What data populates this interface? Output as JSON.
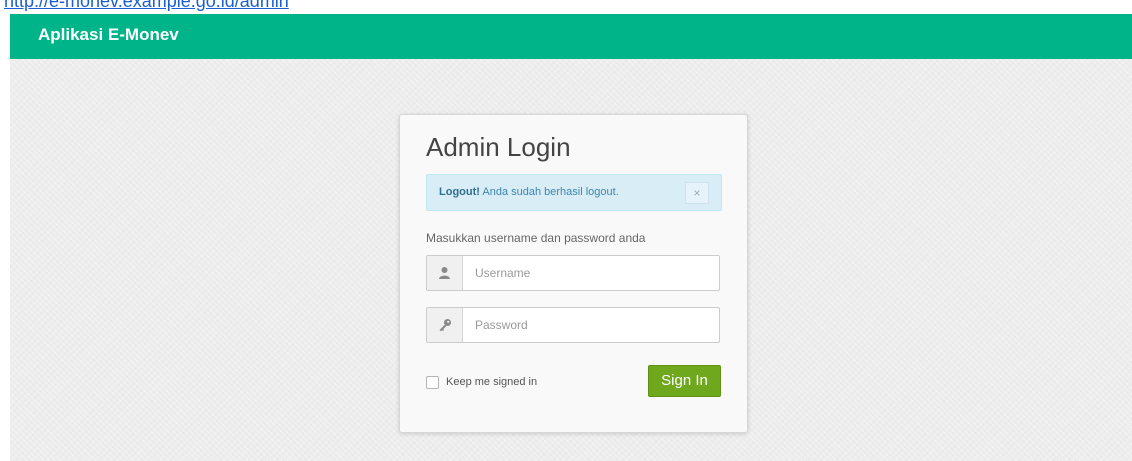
{
  "browser": {
    "url": "http://e-monev.example.go.id/admin"
  },
  "navbar": {
    "brand": "Aplikasi E-Monev"
  },
  "login": {
    "title": "Admin Login",
    "alert": {
      "strong": "Logout!",
      "message": " Anda sudah berhasil logout.",
      "close_label": "×"
    },
    "hint": "Masukkan username dan password anda",
    "username": {
      "placeholder": "Username",
      "value": "",
      "icon": "user-icon"
    },
    "password": {
      "placeholder": "Password",
      "value": "",
      "icon": "key-icon"
    },
    "remember": {
      "label": "Keep me signed in",
      "checked": false
    },
    "submit_label": "Sign In"
  },
  "colors": {
    "navbar": "#00b48a",
    "button": "#6fa81d",
    "alert_bg": "#d9edf7",
    "alert_text": "#3a87ad"
  }
}
